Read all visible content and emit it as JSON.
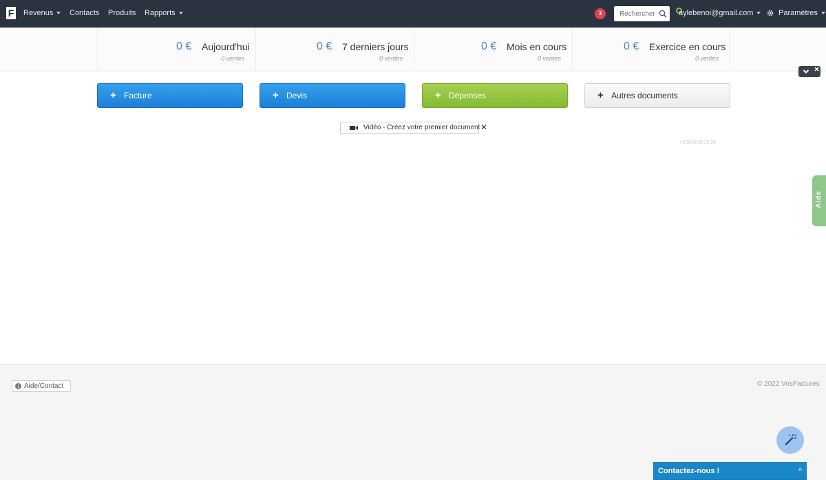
{
  "nav": {
    "logo": "F",
    "revenus": "Revenus",
    "contacts": "Contacts",
    "produits": "Produits",
    "rapports": "Rapports",
    "notifications_count": "3",
    "search_placeholder": "Rechercher",
    "user_email": "aylebenoi@gmail.com",
    "parametres": "Paramètres"
  },
  "stats": [
    {
      "amount": "0 €",
      "label": "Aujourd'hui",
      "sub": "0 ventes"
    },
    {
      "amount": "0 €",
      "label": "7 derniers jours",
      "sub": "0 ventes"
    },
    {
      "amount": "0 €",
      "label": "Mois en cours",
      "sub": "0 ventes"
    },
    {
      "amount": "0 €",
      "label": "Exercice en cours",
      "sub": "0 ventes"
    }
  ],
  "actions": {
    "facture": "Facture",
    "devis": "Devis",
    "depenses": "Dépenses",
    "autres": "Autres documents",
    "plus": "+"
  },
  "video": {
    "label": "Vidéo - Créez votre premier document",
    "close": "✕"
  },
  "version": "v5.58.8.20.15.26",
  "aide_tab": "Aide",
  "footer": {
    "aide_contact": "Aide/Contact",
    "copyright": "© 2022 VosFactures",
    "contact_bar": "Contactez-nous !",
    "contact_chevron": "^"
  },
  "colors": {
    "navbar": "#2b3340",
    "amount": "#4a86c8",
    "blue_button": "#2a92e4",
    "green_button": "#94c43e",
    "notification": "#e0434f",
    "aide_tab": "#8fc78a",
    "contact_bar": "#1a87c8"
  },
  "icons": [
    "logo",
    "caret-down-icon",
    "search-icon",
    "user-status-icon",
    "gear-icon",
    "collapse-chevron-icon",
    "close-icon",
    "plus-icon",
    "video-camera-icon",
    "info-icon",
    "magic-wand-icon"
  ]
}
